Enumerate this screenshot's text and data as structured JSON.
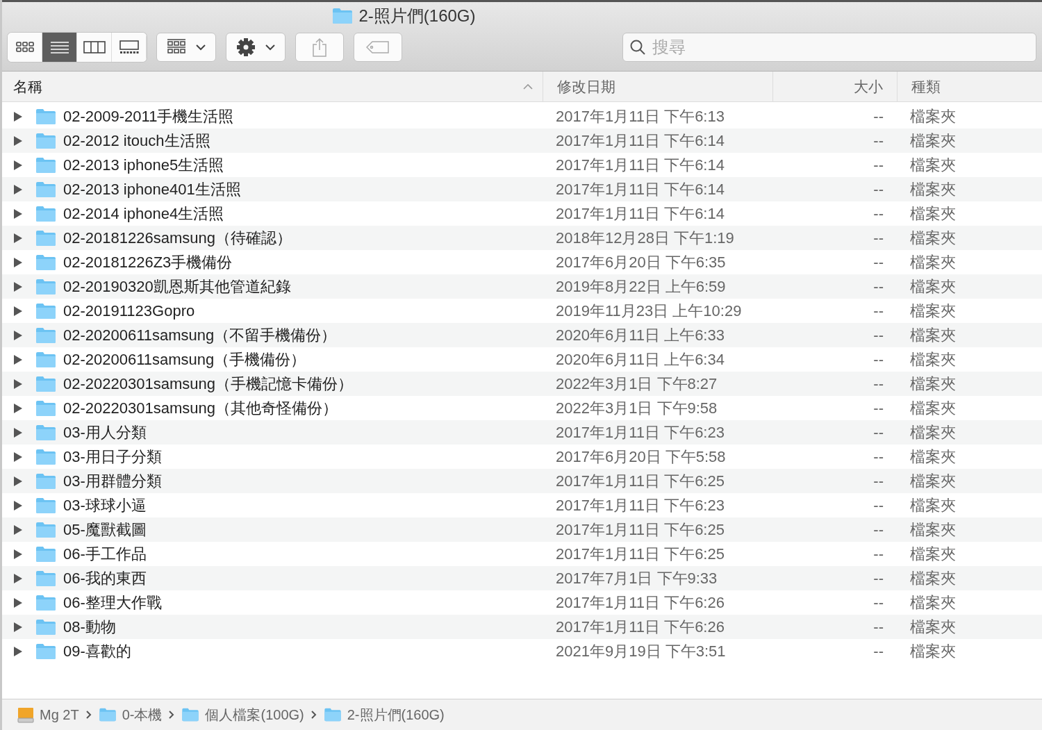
{
  "window": {
    "title": "2-照片們(160G)"
  },
  "toolbar": {
    "view_buttons": [
      {
        "kind": "icons",
        "selected": false
      },
      {
        "kind": "list",
        "selected": true
      },
      {
        "kind": "columns",
        "selected": false
      },
      {
        "kind": "gallery",
        "selected": false
      }
    ]
  },
  "search": {
    "placeholder": "搜尋"
  },
  "table": {
    "columns": [
      {
        "label": "名稱",
        "sorted": true
      },
      {
        "label": "修改日期",
        "sorted": false
      },
      {
        "label": "大小",
        "sorted": false
      },
      {
        "label": "種類",
        "sorted": false
      }
    ],
    "rows": [
      {
        "name": "02-2009-2011手機生活照",
        "modified": "2017年1月11日 下午6:13",
        "size": "--",
        "kind": "檔案夾"
      },
      {
        "name": "02-2012 itouch生活照",
        "modified": "2017年1月11日 下午6:14",
        "size": "--",
        "kind": "檔案夾"
      },
      {
        "name": "02-2013 iphone5生活照",
        "modified": "2017年1月11日 下午6:14",
        "size": "--",
        "kind": "檔案夾"
      },
      {
        "name": "02-2013 iphone401生活照",
        "modified": "2017年1月11日 下午6:14",
        "size": "--",
        "kind": "檔案夾"
      },
      {
        "name": "02-2014 iphone4生活照",
        "modified": "2017年1月11日 下午6:14",
        "size": "--",
        "kind": "檔案夾"
      },
      {
        "name": "02-20181226samsung（待確認）",
        "modified": "2018年12月28日 下午1:19",
        "size": "--",
        "kind": "檔案夾"
      },
      {
        "name": "02-20181226Z3手機備份",
        "modified": "2017年6月20日 下午6:35",
        "size": "--",
        "kind": "檔案夾"
      },
      {
        "name": "02-20190320凱恩斯其他管道紀錄",
        "modified": "2019年8月22日 上午6:59",
        "size": "--",
        "kind": "檔案夾"
      },
      {
        "name": "02-20191123Gopro",
        "modified": "2019年11月23日 上午10:29",
        "size": "--",
        "kind": "檔案夾"
      },
      {
        "name": "02-20200611samsung（不留手機備份）",
        "modified": "2020年6月11日 上午6:33",
        "size": "--",
        "kind": "檔案夾"
      },
      {
        "name": "02-20200611samsung（手機備份）",
        "modified": "2020年6月11日 上午6:34",
        "size": "--",
        "kind": "檔案夾"
      },
      {
        "name": "02-20220301samsung（手機記憶卡備份）",
        "modified": "2022年3月1日 下午8:27",
        "size": "--",
        "kind": "檔案夾"
      },
      {
        "name": "02-20220301samsung（其他奇怪備份）",
        "modified": "2022年3月1日 下午9:58",
        "size": "--",
        "kind": "檔案夾"
      },
      {
        "name": "03-用人分類",
        "modified": "2017年1月11日 下午6:23",
        "size": "--",
        "kind": "檔案夾"
      },
      {
        "name": "03-用日子分類",
        "modified": "2017年6月20日 下午5:58",
        "size": "--",
        "kind": "檔案夾"
      },
      {
        "name": "03-用群體分類",
        "modified": "2017年1月11日 下午6:25",
        "size": "--",
        "kind": "檔案夾"
      },
      {
        "name": "03-球球小逼",
        "modified": "2017年1月11日 下午6:23",
        "size": "--",
        "kind": "檔案夾"
      },
      {
        "name": "05-魔獸截圖",
        "modified": "2017年1月11日 下午6:25",
        "size": "--",
        "kind": "檔案夾"
      },
      {
        "name": "06-手工作品",
        "modified": "2017年1月11日 下午6:25",
        "size": "--",
        "kind": "檔案夾"
      },
      {
        "name": "06-我的東西",
        "modified": "2017年7月1日 下午9:33",
        "size": "--",
        "kind": "檔案夾"
      },
      {
        "name": "06-整理大作戰",
        "modified": "2017年1月11日 下午6:26",
        "size": "--",
        "kind": "檔案夾"
      },
      {
        "name": "08-動物",
        "modified": "2017年1月11日 下午6:26",
        "size": "--",
        "kind": "檔案夾"
      },
      {
        "name": "09-喜歡的",
        "modified": "2021年9月19日 下午3:51",
        "size": "--",
        "kind": "檔案夾"
      }
    ]
  },
  "path_bar": [
    {
      "label": "Mg 2T",
      "kind": "drive"
    },
    {
      "label": "0-本機",
      "kind": "folder"
    },
    {
      "label": "個人檔案(100G)",
      "kind": "folder"
    },
    {
      "label": "2-照片們(160G)",
      "kind": "folder"
    }
  ]
}
